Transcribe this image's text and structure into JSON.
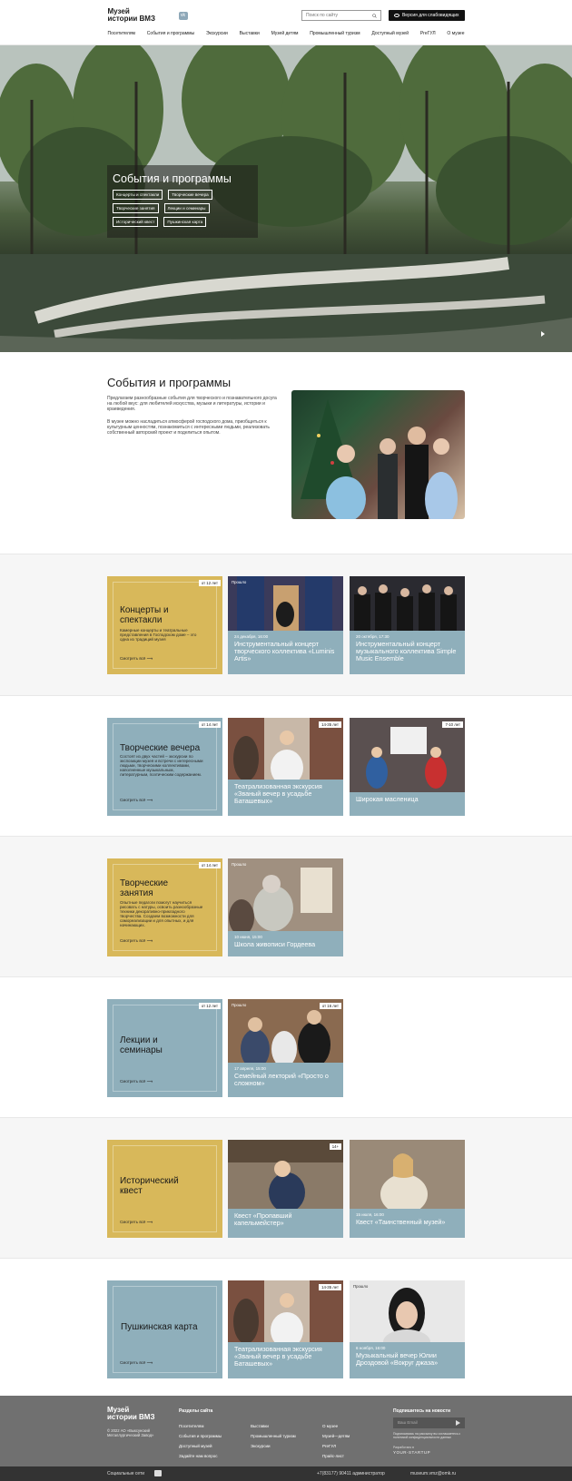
{
  "header": {
    "logo": "Музей\nистории ВМЗ",
    "logo_line1": "Музей",
    "logo_line2": "истории ВМЗ",
    "vk_icon": "vk-icon",
    "search_placeholder": "Поиск по сайту",
    "accessible_label": "Версия для слабовидящих",
    "nav": [
      "Посетителям",
      "События и программы",
      "Экскурсии",
      "Выставки",
      "Музей детям",
      "Промышленный туризм",
      "Доступный музей",
      "PreГУЛ",
      "О музее"
    ]
  },
  "hero": {
    "title": "События и программы",
    "chips": [
      "Концерты и спектакли",
      "Творческие вечера",
      "Творческие занятия",
      "Лекции и семинары",
      "Исторический квест",
      "Пушкинская карта"
    ]
  },
  "intro": {
    "title": "События и программы",
    "p1": "Предлагаем разнообразные события для творческого и познавательного досуга на любой вкус: для любителей искусства, музыки и литературы, истории и краеведения.",
    "p2": "В музее можно насладиться атмосферой господского дома, приобщиться к культурным ценностям, познакомиться с интересными людьми, реализовать собственный авторский проект и поделиться опытом."
  },
  "sections": [
    {
      "category": {
        "title": "Концерты и спектакли",
        "desc": "Камерные концерты и театральные представления в Господском доме – это одна из традиций музея",
        "more": "Смотреть всё",
        "age": "от 12 лет",
        "color": "gold"
      },
      "events": [
        {
          "tag": "Прошло",
          "date": "24 декабря, 16:00",
          "title": "Инструментальный концерт творческого коллектива «Luminis Artis»"
        },
        {
          "tag": "",
          "date": "20 октября, 17:30",
          "title": "Инструментальный концерт музыкального коллектива Simple Music Ensemble"
        }
      ]
    },
    {
      "category": {
        "title": "Творческие вечера",
        "desc": "Состоят из двух частей – экскурсии по экспозиции музея и встречи с интересными людьми, творческими коллективами, наполненные музыкальным, литературным, поэтическим содержанием.",
        "more": "Смотреть всё",
        "age": "от 14 лет",
        "color": "blue"
      },
      "events": [
        {
          "age": "14-35 лет",
          "date": "",
          "title": "Театрализованная экскурсия «Званый вечер в усадьбе Баташевых»"
        },
        {
          "age": "7-10 лет",
          "date": "",
          "title": "Широкая масленица"
        }
      ]
    },
    {
      "category": {
        "title": "Творческие занятия",
        "desc": "Опытные педагоги помогут научиться рисовать с натуры, освоить разнообразные техники декоративно-прикладного творчества. Создаем возможности для самореализации и для опытных, и для начинающих.",
        "more": "Смотреть всё",
        "age": "от 14 лет",
        "color": "gold"
      },
      "events": [
        {
          "tag": "Прошло",
          "date": "10 июня, 15:00",
          "title": "Школа живописи Гордеева"
        }
      ]
    },
    {
      "category": {
        "title": "Лекции и семинары",
        "desc": "",
        "more": "Смотреть всё",
        "age": "от 12 лет",
        "color": "blue"
      },
      "events": [
        {
          "tag": "Прошло",
          "age": "от 16 лет",
          "date": "17 апреля, 15:00",
          "title": "Семейный лекторий «Просто о сложном»"
        }
      ]
    },
    {
      "category": {
        "title": "Исторический квест",
        "desc": "",
        "more": "Смотреть всё",
        "age": "",
        "color": "gold"
      },
      "events": [
        {
          "age": "14+",
          "date": "",
          "title": "Квест «Пропавший капельмейстер»"
        },
        {
          "date": "15 июля, 16:00",
          "title": "Квест «Таинственный музей»"
        }
      ]
    },
    {
      "category": {
        "title": "Пушкинская карта",
        "desc": "",
        "more": "Смотреть всё",
        "age": "",
        "color": "blue"
      },
      "events": [
        {
          "age": "14-35 лет",
          "date": "",
          "title": "Театрализованная экскурсия «Званый вечер в усадьбе Баташевых»"
        },
        {
          "tag": "Прошло",
          "date": "6 ноября, 16:00",
          "title": "Музыкальный вечер Юлии Дроздовой «Вокруг джаза»"
        }
      ]
    }
  ],
  "footer": {
    "logo_line1": "Музей",
    "logo_line2": "истории ВМЗ",
    "copyright": "© 2022 АО «Выксунский Металлургический Завод»",
    "sections_title": "Разделы сайта",
    "col1": [
      "Посетителям",
      "События и программы",
      "Доступный музей",
      "Задайте нам вопрос"
    ],
    "col2": [
      "Выставки",
      "Промышленный туризм",
      "Экскурсии"
    ],
    "col3": [
      "О музее",
      "Музей—детям",
      "PreГУЛ",
      "Прайс-лист"
    ],
    "subscribe_title": "Подпишитесь на новости",
    "email_placeholder": "Ваш Email",
    "note": "Подписываясь на рассылку вы соглашаетесь с политикой конфиденциальности данных",
    "dev_label": "Разработано в",
    "dev_brand": "YOUR-STARTUP",
    "social": "Социальные сети",
    "phone": "+7(83177) 90411 администратор",
    "email": "museum.vmz@omk.ru"
  },
  "colors": {
    "gold": "#d8b85a",
    "blue": "#8fafbb",
    "dark": "#111111",
    "footer": "#707070"
  }
}
